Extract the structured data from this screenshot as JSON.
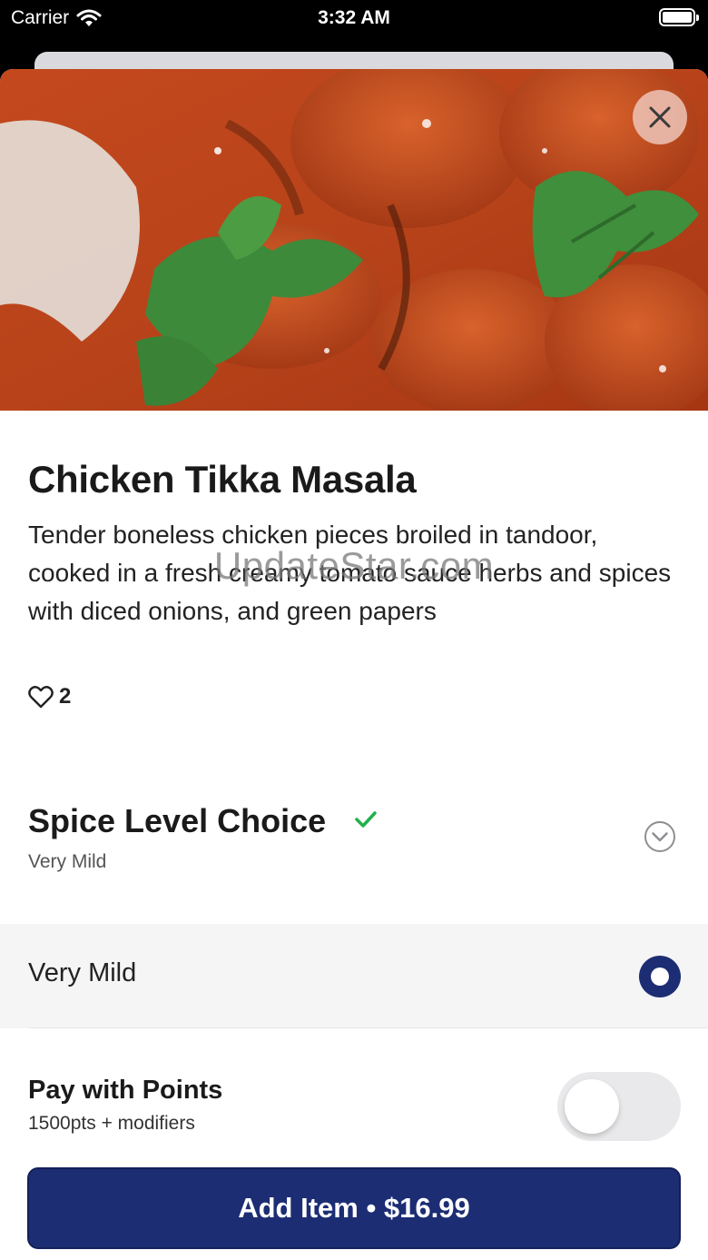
{
  "status_bar": {
    "carrier": "Carrier",
    "time": "3:32 AM"
  },
  "item": {
    "title": "Chicken Tikka Masala",
    "description": "Tender boneless chicken pieces broiled in tandoor, cooked in a fresh creamy tomato sauce herbs and spices with diced onions, and green papers",
    "likes": "2"
  },
  "watermark": "UpdateStar.com",
  "modifier": {
    "title": "Spice Level Choice",
    "selected": "Very Mild",
    "options": [
      {
        "label": "Very Mild",
        "selected": true
      }
    ]
  },
  "points": {
    "title": "Pay with Points",
    "subtitle": "1500pts + modifiers",
    "enabled": false
  },
  "add_button": {
    "label": "Add Item • $16.99"
  },
  "colors": {
    "accent": "#1c2d73",
    "check": "#22b04b"
  },
  "icons": {
    "close": "close-icon",
    "heart": "heart-icon",
    "check": "check-icon",
    "chevron": "chevron-down-icon",
    "wifi": "wifi-icon",
    "battery": "battery-icon"
  }
}
